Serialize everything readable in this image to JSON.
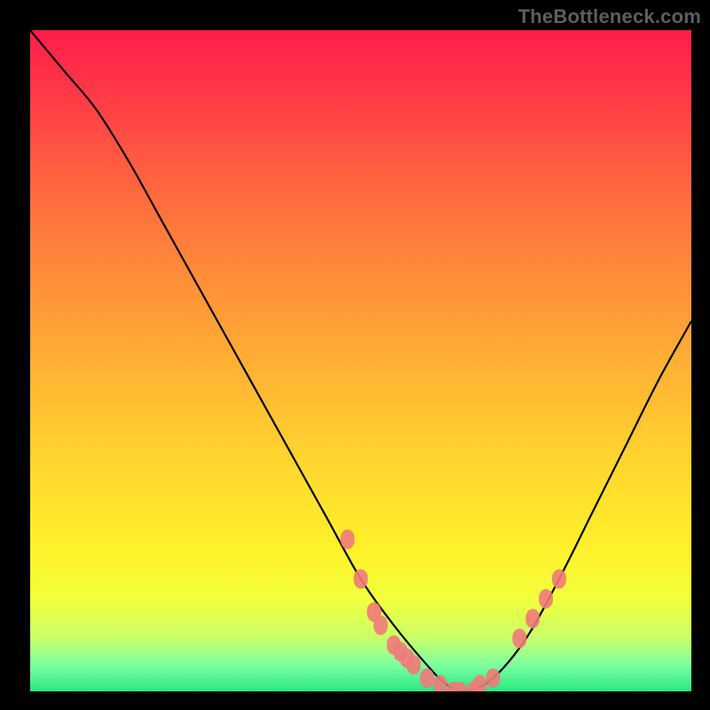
{
  "watermark": {
    "text": "TheBottleneck.com"
  },
  "chart_data": {
    "type": "line",
    "title": "",
    "xlabel": "",
    "ylabel": "",
    "xlim": [
      0,
      100
    ],
    "ylim": [
      0,
      100
    ],
    "grid": false,
    "legend": false,
    "series": [
      {
        "name": "bottleneck-curve",
        "color": "#000000",
        "x": [
          0,
          5,
          10,
          15,
          20,
          25,
          30,
          35,
          40,
          45,
          50,
          55,
          60,
          63,
          66,
          70,
          75,
          80,
          85,
          90,
          95,
          100
        ],
        "y": [
          100,
          94,
          88,
          80,
          71,
          62,
          53,
          44,
          35,
          26,
          17,
          10,
          4,
          1,
          0,
          2,
          8,
          17,
          27,
          37,
          47,
          56
        ]
      },
      {
        "name": "highlight-dots-left",
        "color": "#f07a7a",
        "style": "marker",
        "x": [
          48,
          50,
          52,
          53,
          55,
          56,
          57,
          58
        ],
        "y": [
          23,
          17,
          12,
          10,
          7,
          6,
          5,
          4
        ]
      },
      {
        "name": "highlight-dots-bottom",
        "color": "#f07a7a",
        "style": "marker",
        "x": [
          60,
          62,
          64,
          65,
          67,
          68,
          70
        ],
        "y": [
          2,
          1,
          0,
          0,
          0,
          1,
          2
        ]
      },
      {
        "name": "highlight-dots-right",
        "color": "#f07a7a",
        "style": "marker",
        "x": [
          74,
          76,
          78,
          80
        ],
        "y": [
          8,
          11,
          14,
          17
        ]
      }
    ],
    "background_gradient": {
      "direction": "vertical",
      "stops": [
        {
          "pos": 0.0,
          "color": "#ff1d4a"
        },
        {
          "pos": 0.45,
          "color": "#ffa236"
        },
        {
          "pos": 0.78,
          "color": "#fff02a"
        },
        {
          "pos": 1.0,
          "color": "#28e884"
        }
      ]
    }
  }
}
